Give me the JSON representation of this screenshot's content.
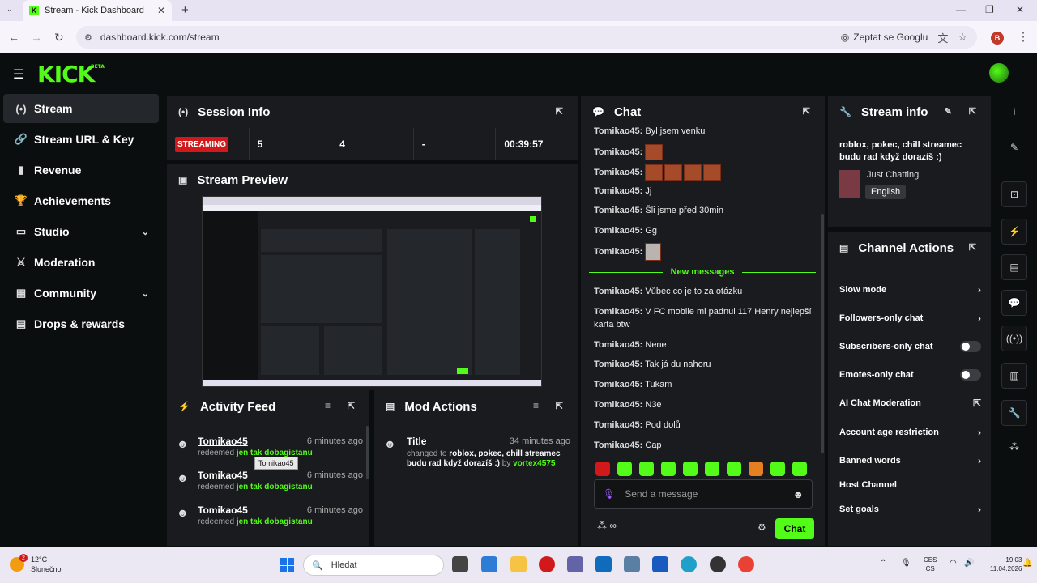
{
  "browser": {
    "tab_title": "Stream - Kick Dashboard",
    "tab_favicon": "K",
    "url": "dashboard.kick.com/stream",
    "ask_google": "Zeptat se Googlu",
    "profile_initial": "B"
  },
  "app": {
    "logo": "KICK",
    "logo_badge": "BETA",
    "accent": "#53fc18"
  },
  "sidebar": {
    "items": [
      {
        "label": "Stream",
        "icon": "broadcast-icon",
        "glyph": "(•)",
        "active": true
      },
      {
        "label": "Stream URL & Key",
        "icon": "link-icon",
        "glyph": "🔗"
      },
      {
        "label": "Revenue",
        "icon": "chart-icon",
        "glyph": "▮"
      },
      {
        "label": "Achievements",
        "icon": "trophy-icon",
        "glyph": "🏆"
      },
      {
        "label": "Studio",
        "icon": "studio-icon",
        "glyph": "▭",
        "chevron": "⌄"
      },
      {
        "label": "Moderation",
        "icon": "sword-icon",
        "glyph": "⚔"
      },
      {
        "label": "Community",
        "icon": "community-icon",
        "glyph": "▦",
        "chevron": "⌄"
      },
      {
        "label": "Drops & rewards",
        "icon": "drops-icon",
        "glyph": "▤"
      }
    ]
  },
  "session": {
    "title": "Session Info",
    "status": "STREAMING",
    "viewers": "5",
    "followers": "4",
    "subs": "-",
    "duration": "00:39:57"
  },
  "preview": {
    "title": "Stream Preview"
  },
  "activity": {
    "title": "Activity Feed",
    "items": [
      {
        "user": "Tomikao45",
        "time": "6 minutes ago",
        "verb": "redeemed",
        "reward": "jen tak dobagistanu"
      },
      {
        "user": "Tomikao45",
        "time": "6 minutes ago",
        "verb": "redeemed",
        "reward": "jen tak dobagistanu"
      },
      {
        "user": "Tomikao45",
        "time": "6 minutes ago",
        "verb": "redeemed",
        "reward": "jen tak dobagistanu"
      }
    ],
    "tooltip": "Tomikao45"
  },
  "mod": {
    "title": "Mod Actions",
    "entry": {
      "title": "Title",
      "time": "34 minutes ago",
      "prefix": "changed to",
      "value": "roblox, pokec, chill streamec budu rad když dorazíš :)",
      "by": "by",
      "moderator": "vortex4575"
    }
  },
  "chat": {
    "title": "Chat",
    "messages": [
      {
        "user": "Tomikao45:",
        "text": "Byl jsem venku"
      },
      {
        "user": "Tomikao45:",
        "emotes": 1
      },
      {
        "user": "Tomikao45:",
        "emotes": 4
      },
      {
        "user": "Tomikao45:",
        "text": "Jj"
      },
      {
        "user": "Tomikao45:",
        "text": "Šli jsme před 30min"
      },
      {
        "user": "Tomikao45:",
        "text": "Gg"
      },
      {
        "user": "Tomikao45:",
        "emotes_small": 1
      }
    ],
    "new_messages": "New messages",
    "messages_new": [
      {
        "user": "Tomikao45:",
        "text": "Vůbec co je to za otázku"
      },
      {
        "user": "Tomikao45:",
        "text": "V FC mobile mi padnul 117 Henry nejlepší karta btw"
      },
      {
        "user": "Tomikao45:",
        "text": "Nene"
      },
      {
        "user": "Tomikao45:",
        "text": "Tak já du nahoru"
      },
      {
        "user": "Tomikao45:",
        "text": "Tukam"
      },
      {
        "user": "Tomikao45:",
        "text": "N3e"
      },
      {
        "user": "Tomikao45:",
        "text": "Pod dolů"
      },
      {
        "user": "Tomikao45:",
        "text": "Cap"
      }
    ],
    "quick_emote_colors": [
      "#d1191c",
      "#53fc18",
      "#53fc18",
      "#53fc18",
      "#53fc18",
      "#53fc18",
      "#53fc18",
      "#e67e22",
      "#53fc18",
      "#53fc18"
    ],
    "placeholder": "Send a message",
    "send_label": "Chat",
    "bottom_left": "∞"
  },
  "stream_info": {
    "title": "Stream info",
    "stream_title": "roblox, pokec, chill streamec budu rad když dorazíš :)",
    "category": "Just Chatting",
    "language": "English"
  },
  "channel_actions": {
    "title": "Channel Actions",
    "items": [
      {
        "label": "Slow mode",
        "control": "arrow"
      },
      {
        "label": "Followers-only chat",
        "control": "arrow"
      },
      {
        "label": "Subscribers-only chat",
        "control": "toggle"
      },
      {
        "label": "Emotes-only chat",
        "control": "toggle"
      },
      {
        "label": "AI Chat Moderation",
        "control": "external"
      },
      {
        "label": "Account age restriction",
        "control": "arrow"
      },
      {
        "label": "Banned words",
        "control": "arrow"
      },
      {
        "label": "Host Channel",
        "control": "none"
      },
      {
        "label": "Set goals",
        "control": "arrow"
      }
    ]
  },
  "rail": [
    {
      "name": "info-icon",
      "glyph": "i"
    },
    {
      "name": "edit-icon",
      "glyph": "✎"
    },
    {
      "name": "capture-icon",
      "glyph": "⊡"
    },
    {
      "name": "bolt-icon",
      "glyph": "⚡"
    },
    {
      "name": "document-icon",
      "glyph": "▤"
    },
    {
      "name": "chat-icon",
      "glyph": "💬"
    },
    {
      "name": "broadcast-icon",
      "glyph": "((•))"
    },
    {
      "name": "layout-icon",
      "glyph": "▥"
    },
    {
      "name": "wrench-icon",
      "glyph": "🔧"
    },
    {
      "name": "users-icon",
      "glyph": "⁂"
    }
  ],
  "taskbar": {
    "temp": "12°C",
    "weather": "Slunečno",
    "weather_badge": "2",
    "search": "Hledat",
    "lang_top": "CES",
    "lang_bottom": "CS",
    "time": "19:03",
    "date": "11.04.2026"
  }
}
